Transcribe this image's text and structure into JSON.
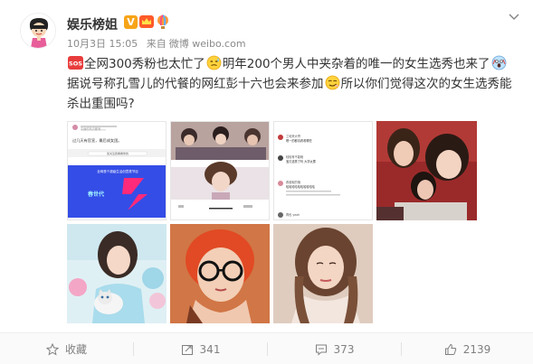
{
  "post": {
    "username": "娱乐榜姐",
    "vip_label": "V",
    "date": "10月3日 15:05",
    "source_prefix": "来自",
    "source": "微博 weibo.com",
    "sos_label": "SOS",
    "text_part1": "全网300秀粉也太忙了",
    "text_part2": "明年200个男人中夹杂着的唯一的女生选秀也来了",
    "text_part3": "据说号称孔雪儿的代餐的网红彭十六也会来参加",
    "text_part4": "所以你们觉得这次的女生选秀能杀出重围吗?"
  },
  "thumb1": {
    "small_header": "平面的东方都有",
    "line1": "过几天有官宣，最后成女团。",
    "button": "加关注我看看你的",
    "promo_text": "全网首个超级生活创意类节目",
    "promo_label": "春世代"
  },
  "thumb3": {
    "comments": [
      {
        "name": "工地来大哥",
        "text": "嗯一的都请看看哪些"
      },
      {
        "name": "轻轻有不能暗",
        "text": "宝贝选秀了吗 大学太累"
      },
      {
        "name": "看着取的哦",
        "text": "哈哈哈哈哈哈哈哈哈哈"
      },
      {
        "name": "再也 yeah",
        "text": ""
      }
    ]
  },
  "actions": {
    "favorite_label": "收藏",
    "repost_count": "341",
    "comment_count": "373",
    "like_count": "2139"
  },
  "icons": [
    "avatar-icon",
    "crown-icon",
    "balloon-icon",
    "chevron-down-icon",
    "sos-icon",
    "emoji-sweat-icon",
    "emoji-scream-icon",
    "emoji-smirk-icon",
    "star-icon",
    "share-icon",
    "comment-icon",
    "like-icon"
  ],
  "colors": {
    "vip": "#f7a418",
    "sos": "#e83c3c",
    "meta": "#8a8a8a",
    "action": "#808080"
  }
}
